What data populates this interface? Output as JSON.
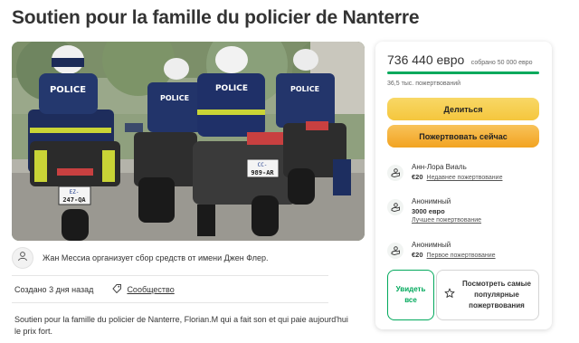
{
  "page": {
    "title": "Soutien pour la famille du policier de Nanterre"
  },
  "hero": {
    "plates": [
      "EZ-247-QA",
      "CC-989-AR"
    ],
    "vest_text": "POLICE"
  },
  "organizer": {
    "text": "Жан Мессиа организует сбор средств от имени Джен Флер.",
    "icon": "person-icon"
  },
  "meta": {
    "created": "Создано 3 дня назад",
    "category": "Сообщество",
    "category_icon": "tag-icon"
  },
  "description": "Soutien pour la famille du policier de Nanterre, Florian.M qui a fait son et qui paie aujourd'hui le prix fort.",
  "card": {
    "raised": "736 440 евро",
    "goal": "собрано 50 000 евро",
    "progress_percent": 100,
    "progress_color": "#02a95c",
    "donations": "36,5 тыс. пожертвований",
    "share_label": "Делиться",
    "donate_label": "Пожертвовать сейчас",
    "donors": [
      {
        "name": "Анн-Лора Виаль",
        "amount": "€20",
        "tag": "Недавнее пожертвование"
      },
      {
        "name": "Анонимный",
        "amount": "3000 евро",
        "tag": "Лучшее пожертвование"
      },
      {
        "name": "Анонимный",
        "amount": "€20",
        "tag": "Первое пожертвование"
      }
    ],
    "see_all_label": "Увидеть все",
    "see_top_label": "Посмотреть самые популярные пожертвования",
    "accent_color": "#02a95c",
    "share_color": "#f6cd4a",
    "donate_color": "#f4ad2e"
  }
}
